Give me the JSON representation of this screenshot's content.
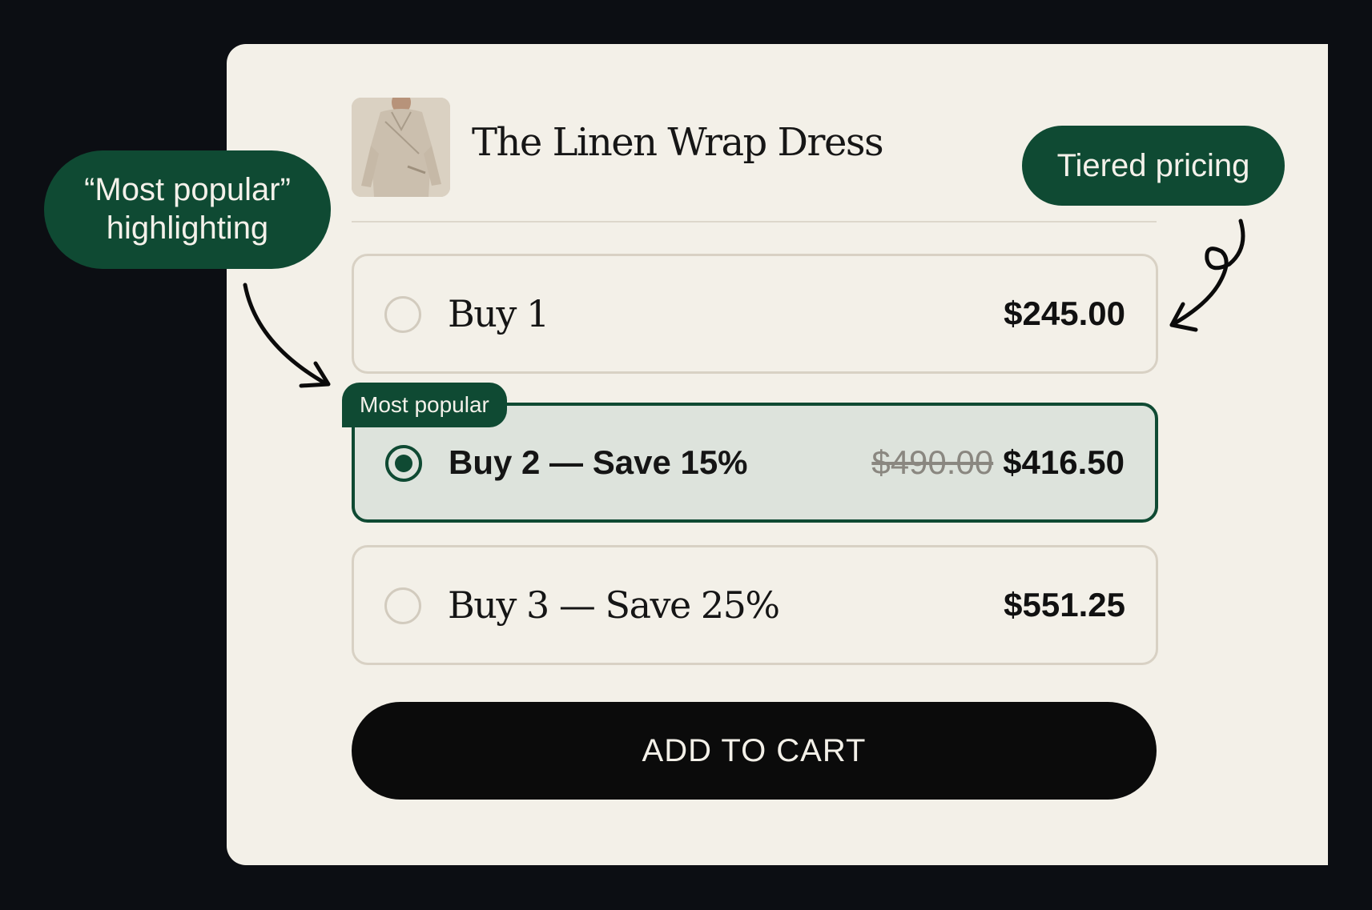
{
  "product": {
    "title": "The Linen Wrap Dress",
    "image_alt": "linen wrap dress photo"
  },
  "options": [
    {
      "label": "Buy 1",
      "price": "$245.00",
      "old_price": "",
      "selected": false
    },
    {
      "label": "Buy 2 — Save 15%",
      "price": "$416.50",
      "old_price": "$490.00",
      "selected": true,
      "badge": "Most popular"
    },
    {
      "label": "Buy 3 — Save 25%",
      "price": "$551.25",
      "old_price": "",
      "selected": false
    }
  ],
  "cart_button": {
    "label": "ADD TO CART"
  },
  "callouts": {
    "left_line1": "“Most popular”",
    "left_line2": "highlighting",
    "right": "Tiered pricing"
  },
  "colors": {
    "accent": "#0f4a33",
    "card_bg": "#f3f0e8",
    "page_bg": "#0c0e13",
    "selected_bg": "#dde3dc",
    "button_bg": "#0b0b0b"
  },
  "icons": {
    "radio_selected": "radio-checked-icon",
    "radio_unselected": "radio-unchecked-icon",
    "arrow_left": "curved-arrow-icon",
    "arrow_right": "loop-arrow-icon"
  }
}
